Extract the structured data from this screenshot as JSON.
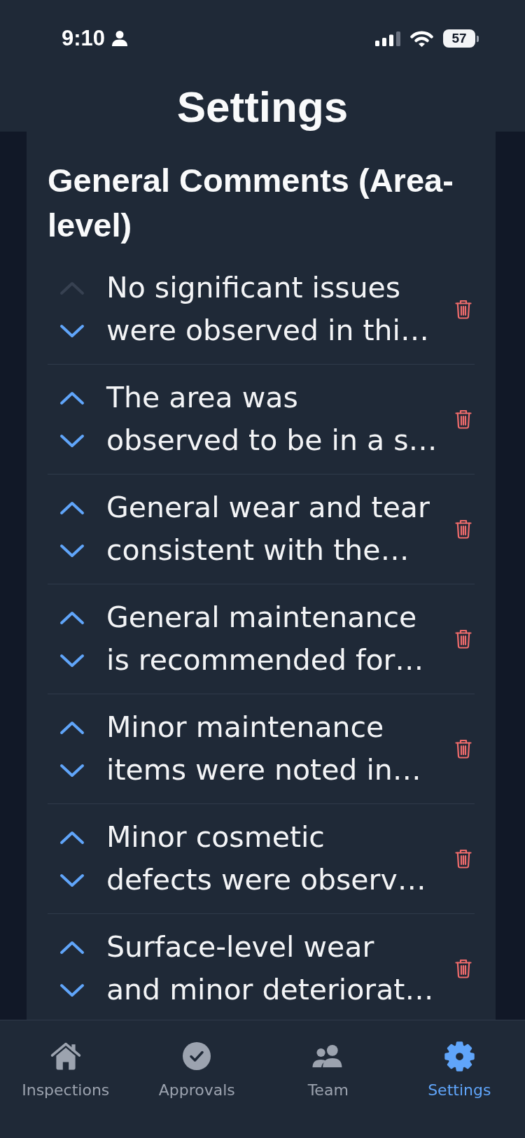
{
  "status_bar": {
    "time": "9:10",
    "battery": "57"
  },
  "header": {
    "title": "Settings"
  },
  "section": {
    "title": "General Comments (Area-level)",
    "comments": [
      {
        "text": "No significant issues\nwere observed in thi…",
        "up_disabled": true,
        "down_disabled": false
      },
      {
        "text": "The area was\nobserved to be in a s…",
        "up_disabled": false,
        "down_disabled": false
      },
      {
        "text": "General wear and tear\nconsistent with the…",
        "up_disabled": false,
        "down_disabled": false
      },
      {
        "text": "General maintenance\nis recommended for…",
        "up_disabled": false,
        "down_disabled": false
      },
      {
        "text": "Minor maintenance\nitems were noted in…",
        "up_disabled": false,
        "down_disabled": false
      },
      {
        "text": "Minor cosmetic\ndefects were observ…",
        "up_disabled": false,
        "down_disabled": false
      },
      {
        "text": "Surface-level wear\nand minor deteriorat…",
        "up_disabled": false,
        "down_disabled": false
      }
    ]
  },
  "tab_bar": {
    "tabs": [
      {
        "label": "Inspections",
        "selected": false
      },
      {
        "label": "Approvals",
        "selected": false
      },
      {
        "label": "Team",
        "selected": false
      },
      {
        "label": "Settings",
        "selected": true
      }
    ]
  }
}
